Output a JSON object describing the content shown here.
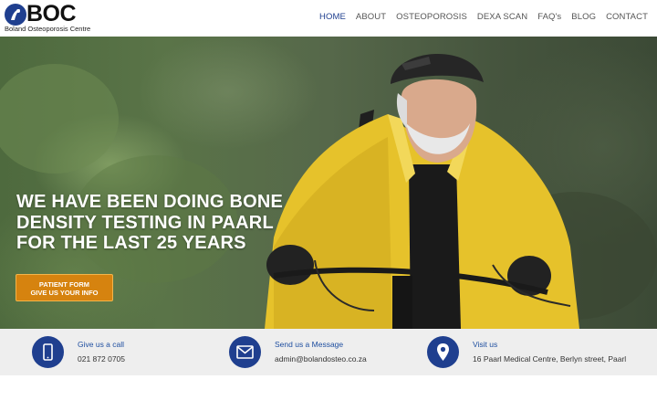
{
  "brand": {
    "logo_text": "BOC",
    "logo_subtitle": "Boland Osteoporosis Centre"
  },
  "nav": {
    "items": [
      {
        "label": "HOME",
        "active": true
      },
      {
        "label": "ABOUT",
        "active": false
      },
      {
        "label": "OSTEOPOROSIS",
        "active": false
      },
      {
        "label": "DEXA SCAN",
        "active": false
      },
      {
        "label": "FAQ's",
        "active": false
      },
      {
        "label": "BLOG",
        "active": false
      },
      {
        "label": "CONTACT",
        "active": false
      }
    ]
  },
  "hero": {
    "title_lines": [
      "WE HAVE BEEN DOING BONE",
      "DENSITY TESTING IN PAARL",
      "FOR THE LAST 25 YEARS"
    ],
    "cta_lines": [
      "PATIENT FORM",
      "GIVE US YOUR INFO"
    ]
  },
  "contact": {
    "call": {
      "title": "Give us a call",
      "value": "021 872 0705",
      "icon": "phone-icon"
    },
    "message": {
      "title": "Send us a Message",
      "value": "admin@bolandosteo.co.za",
      "icon": "envelope-icon"
    },
    "visit": {
      "title": "Visit us",
      "value": "16 Paarl Medical Centre, Berlyn street, Paarl",
      "icon": "map-pin-icon"
    }
  },
  "colors": {
    "brand_blue": "#1f3f8f",
    "cta_orange": "#d6830f",
    "info_bar": "#eeeeee"
  }
}
